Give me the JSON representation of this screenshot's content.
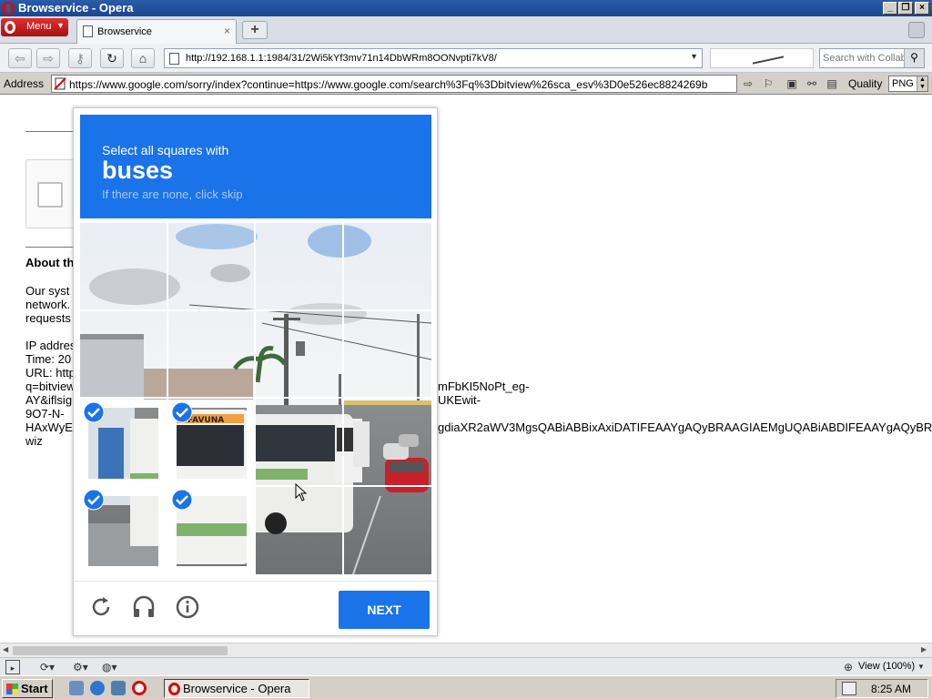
{
  "window": {
    "title": "Browservice - Opera"
  },
  "tabs": {
    "menu_label": "Menu",
    "active_tab": "Browservice",
    "close_glyph": "×",
    "new_tab_glyph": "+"
  },
  "nav": {
    "url": "http://192.168.1.1:1984/31/2Wi5kYf3mv71n14DbWRm8OONvpti7kV8/",
    "search_placeholder": "Search with Collab'"
  },
  "addressbar": {
    "label": "Address",
    "url": "https://www.google.com/sorry/index?continue=https://www.google.com/search%3Fq%3Dbitview%26sca_esv%3D0e526ec8824269b",
    "quality_label": "Quality",
    "quality_value": "PNG"
  },
  "page": {
    "about_heading": "About th",
    "para1_line1": "Our syst",
    "para1_line2": "network.",
    "para1_line3": "requests",
    "ip_line": "IP addres",
    "time_line": "Time: 20",
    "url_line": "URL: http",
    "q_line": "q=bitview",
    "ay_line": "AY&iflsig",
    "no_line": "9O7-N-",
    "hax_line": "HAxWyE",
    "wiz_line": "wiz",
    "frag1": "mFbKI5NoPt_eg-",
    "frag2": "UKEwit-",
    "frag3": "gdiaXR2aWV3MgsQABiABBixAxiDATIFEAAYgAQyBRAAGIAEMgUQABiABDIFEAAYgAQyBRAAGI"
  },
  "captcha": {
    "instruction": "Select all squares with",
    "target": "buses",
    "hint": "If there are none, click skip",
    "next_label": "NEXT",
    "selected_tiles": [
      1,
      2,
      4,
      5
    ],
    "icons": [
      "reload-icon",
      "headphones-icon",
      "info-icon"
    ]
  },
  "statusbar": {
    "zoom": "View (100%)"
  },
  "taskbar": {
    "start_label": "Start",
    "task_label": "Browservice - Opera",
    "clock": "8:25 AM"
  },
  "colors": {
    "captcha_blue": "#1a73e8",
    "title_bar": "#2a5ca8",
    "checkmark": "#1a73e8"
  }
}
